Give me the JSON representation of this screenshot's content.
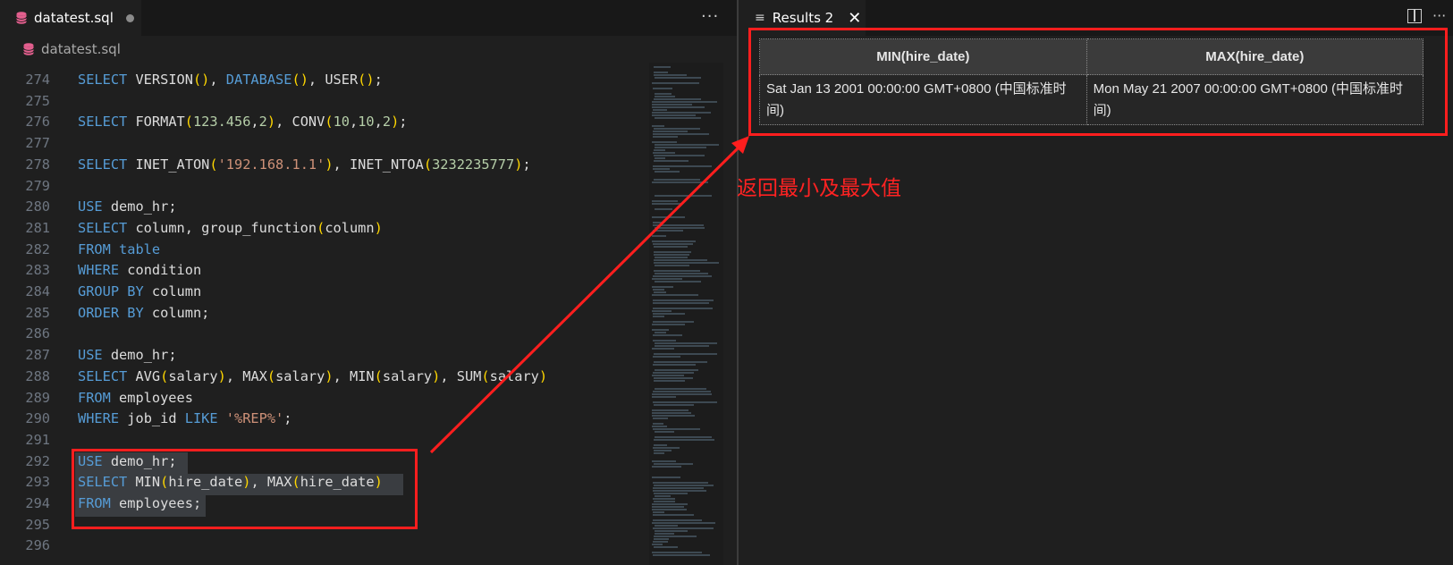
{
  "editor": {
    "tab": {
      "filename": "datatest.sql",
      "dirty": true
    },
    "breadcrumb": "datatest.sql",
    "more_actions": "···",
    "lines": [
      {
        "num": "274",
        "tokens": [
          [
            "kw",
            "SELECT"
          ],
          [
            "fn",
            " VERSION"
          ],
          [
            "br",
            "()"
          ],
          [
            "fn",
            ", "
          ],
          [
            "kw",
            "DATABASE"
          ],
          [
            "br",
            "()"
          ],
          [
            "fn",
            ", USER"
          ],
          [
            "br",
            "()"
          ],
          [
            "fn",
            ";"
          ]
        ]
      },
      {
        "num": "275",
        "tokens": []
      },
      {
        "num": "276",
        "tokens": [
          [
            "kw",
            "SELECT"
          ],
          [
            "fn",
            " FORMAT"
          ],
          [
            "br",
            "("
          ],
          [
            "num",
            "123.456"
          ],
          [
            "fn",
            ","
          ],
          [
            "num",
            "2"
          ],
          [
            "br",
            ")"
          ],
          [
            "fn",
            ", CONV"
          ],
          [
            "br",
            "("
          ],
          [
            "num",
            "10"
          ],
          [
            "fn",
            ","
          ],
          [
            "num",
            "10"
          ],
          [
            "fn",
            ","
          ],
          [
            "num",
            "2"
          ],
          [
            "br",
            ")"
          ],
          [
            "fn",
            ";"
          ]
        ]
      },
      {
        "num": "277",
        "tokens": []
      },
      {
        "num": "278",
        "tokens": [
          [
            "kw",
            "SELECT"
          ],
          [
            "fn",
            " INET_ATON"
          ],
          [
            "br",
            "("
          ],
          [
            "str",
            "'192.168.1.1'"
          ],
          [
            "br",
            ")"
          ],
          [
            "fn",
            ", INET_NTOA"
          ],
          [
            "br",
            "("
          ],
          [
            "num",
            "3232235777"
          ],
          [
            "br",
            ")"
          ],
          [
            "fn",
            ";"
          ]
        ]
      },
      {
        "num": "279",
        "tokens": []
      },
      {
        "num": "280",
        "tokens": [
          [
            "kw",
            "USE"
          ],
          [
            "fn",
            " demo_hr;"
          ]
        ]
      },
      {
        "num": "281",
        "tokens": [
          [
            "kw",
            "SELECT"
          ],
          [
            "fn",
            " column, group_function"
          ],
          [
            "br",
            "("
          ],
          [
            "fn",
            "column"
          ],
          [
            "br",
            ")"
          ]
        ]
      },
      {
        "num": "282",
        "tokens": [
          [
            "kw",
            "FROM"
          ],
          [
            "kw",
            " table"
          ]
        ]
      },
      {
        "num": "283",
        "tokens": [
          [
            "kw",
            "WHERE"
          ],
          [
            "fn",
            " condition"
          ]
        ]
      },
      {
        "num": "284",
        "tokens": [
          [
            "kw",
            "GROUP BY"
          ],
          [
            "fn",
            " column"
          ]
        ]
      },
      {
        "num": "285",
        "tokens": [
          [
            "kw",
            "ORDER BY"
          ],
          [
            "fn",
            " column;"
          ]
        ]
      },
      {
        "num": "286",
        "tokens": []
      },
      {
        "num": "287",
        "tokens": [
          [
            "kw",
            "USE"
          ],
          [
            "fn",
            " demo_hr;"
          ]
        ]
      },
      {
        "num": "288",
        "tokens": [
          [
            "kw",
            "SELECT"
          ],
          [
            "fn",
            " AVG"
          ],
          [
            "br",
            "("
          ],
          [
            "fn",
            "salary"
          ],
          [
            "br",
            ")"
          ],
          [
            "fn",
            ", MAX"
          ],
          [
            "br",
            "("
          ],
          [
            "fn",
            "salary"
          ],
          [
            "br",
            ")"
          ],
          [
            "fn",
            ", MIN"
          ],
          [
            "br",
            "("
          ],
          [
            "fn",
            "salary"
          ],
          [
            "br",
            ")"
          ],
          [
            "fn",
            ", SUM"
          ],
          [
            "br",
            "("
          ],
          [
            "fn",
            "salary"
          ],
          [
            "br",
            ")"
          ]
        ]
      },
      {
        "num": "289",
        "tokens": [
          [
            "kw",
            "FROM"
          ],
          [
            "fn",
            " employees"
          ]
        ]
      },
      {
        "num": "290",
        "tokens": [
          [
            "kw",
            "WHERE"
          ],
          [
            "fn",
            " job_id "
          ],
          [
            "kw",
            "LIKE"
          ],
          [
            "str",
            " '%REP%'"
          ],
          [
            "fn",
            ";"
          ]
        ]
      },
      {
        "num": "291",
        "tokens": []
      },
      {
        "num": "292",
        "tokens": [
          [
            "kw",
            "USE"
          ],
          [
            "fn",
            " demo_hr;"
          ]
        ]
      },
      {
        "num": "293",
        "tokens": [
          [
            "kw",
            "SELECT"
          ],
          [
            "fn",
            " MIN"
          ],
          [
            "br",
            "("
          ],
          [
            "fn",
            "hire_date"
          ],
          [
            "br",
            ")"
          ],
          [
            "fn",
            ", MAX"
          ],
          [
            "br",
            "("
          ],
          [
            "fn",
            "hire_date"
          ],
          [
            "br",
            ")"
          ]
        ]
      },
      {
        "num": "294",
        "tokens": [
          [
            "kw",
            "FROM"
          ],
          [
            "fn",
            " employees;"
          ]
        ]
      },
      {
        "num": "295",
        "tokens": []
      },
      {
        "num": "296",
        "tokens": []
      }
    ]
  },
  "results": {
    "tab_label": "Results 2",
    "columns": [
      "MIN(hire_date)",
      "MAX(hire_date)"
    ],
    "rows": [
      [
        "Sat Jan 13 2001 00:00:00 GMT+0800 (中国标准时间)",
        "Mon May 21 2007 00:00:00 GMT+0800 (中国标准时间)"
      ]
    ]
  },
  "annotation": {
    "text": "返回最小及最大值",
    "color": "#ff2222"
  }
}
